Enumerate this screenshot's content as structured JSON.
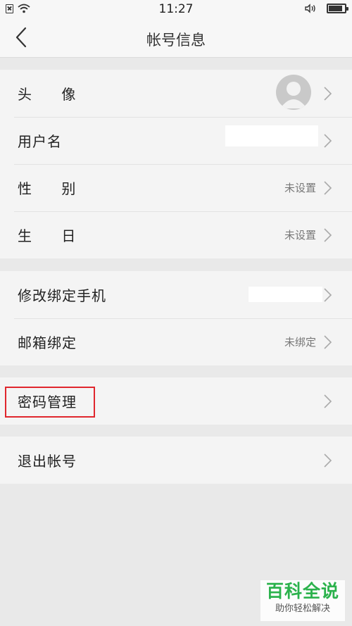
{
  "status_bar": {
    "time": "11:27"
  },
  "nav": {
    "title": "帐号信息"
  },
  "groups": [
    {
      "rows": [
        {
          "label": "头 像"
        },
        {
          "label": "用户名"
        },
        {
          "label": "性 别",
          "value": "未设置"
        },
        {
          "label": "生 日",
          "value": "未设置"
        }
      ]
    },
    {
      "rows": [
        {
          "label": "修改绑定手机"
        },
        {
          "label": "邮箱绑定",
          "value": "未绑定"
        }
      ]
    },
    {
      "rows": [
        {
          "label": "密码管理"
        }
      ]
    },
    {
      "rows": [
        {
          "label": "退出帐号"
        }
      ]
    }
  ],
  "colors": {
    "highlight": "#e0262d",
    "watermark_green": "#2bb24c"
  },
  "watermark": {
    "title": "百科全说",
    "subtitle": "助你轻松解决"
  }
}
